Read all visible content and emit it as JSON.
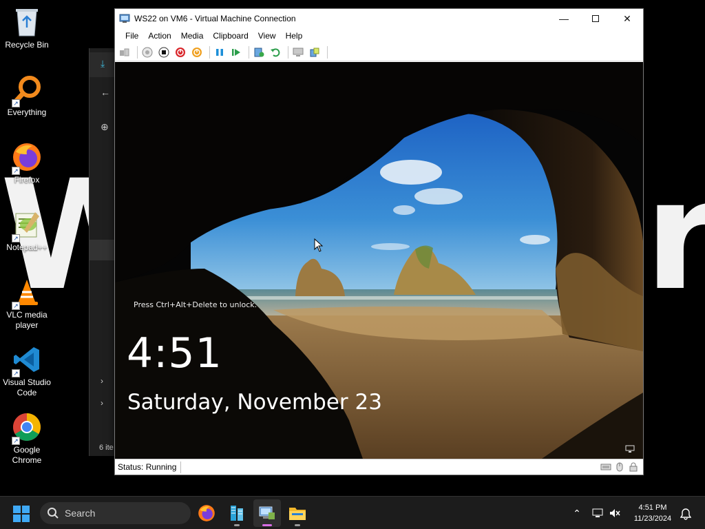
{
  "desktop": {
    "wallpaper_left": "W",
    "wallpaper_right": "r",
    "icons": [
      {
        "label": "Recycle Bin",
        "icon": "recycle-bin-icon"
      },
      {
        "label": "Everything",
        "icon": "everything-search-icon"
      },
      {
        "label": "Firefox",
        "icon": "firefox-icon"
      },
      {
        "label": "Notepad++",
        "icon": "notepadpp-icon"
      },
      {
        "label": "VLC media player",
        "icon": "vlc-icon"
      },
      {
        "label": "Visual Studio Code",
        "icon": "vscode-icon"
      },
      {
        "label": "Google Chrome",
        "icon": "chrome-icon"
      }
    ],
    "background_window": {
      "item_count": "6 ite"
    }
  },
  "vm_window": {
    "title": "WS22 on VM6 - Virtual Machine Connection",
    "menu": [
      "File",
      "Action",
      "Media",
      "Clipboard",
      "View",
      "Help"
    ],
    "toolbar_icons": [
      "ctrl-alt-del-icon",
      "start-icon",
      "turn-off-icon",
      "shutdown-icon",
      "power-icon",
      "pause-icon",
      "resume-icon",
      "checkpoint-icon",
      "revert-icon",
      "enhanced-session-icon",
      "share-icon"
    ],
    "lock_screen": {
      "hint": "Press Ctrl+Alt+Delete to unlock.",
      "time": "4:51",
      "date": "Saturday, November 23"
    },
    "status": "Status: Running"
  },
  "taskbar": {
    "search_placeholder": "Search",
    "clock_time": "4:51 PM",
    "clock_date": "11/23/2024"
  },
  "colors": {
    "accent_blue": "#0078d4",
    "sky": "#2f7fd0",
    "sand": "#b88a4a",
    "taskbar": "#1c1c1c"
  }
}
